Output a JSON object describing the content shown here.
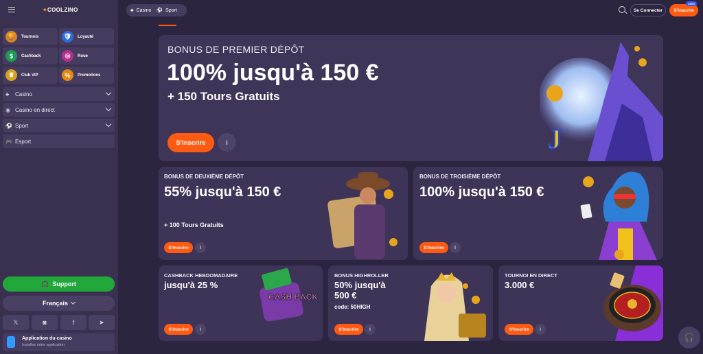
{
  "brand": {
    "name_prefix": "",
    "name": "COOLZINO"
  },
  "sidebar": {
    "tiles": [
      {
        "label": "Tournois",
        "icon": "trophy-icon",
        "color": "#d7832a"
      },
      {
        "label": "Loyauté",
        "icon": "shield-icon",
        "color": "#2e6bd6"
      },
      {
        "label": "Cashback",
        "icon": "cashback-icon",
        "color": "#1c9a55"
      },
      {
        "label": "Roue",
        "icon": "wheel-icon",
        "color": "#b6318f"
      },
      {
        "label": "Club VIP",
        "icon": "crown-icon",
        "color": "#d9a21f"
      },
      {
        "label": "Promotions",
        "icon": "percent-icon",
        "color": "#e48a12"
      }
    ],
    "nav": [
      {
        "label": "Casino",
        "icon": "cards-icon"
      },
      {
        "label": "Casino en direct",
        "icon": "live-icon"
      },
      {
        "label": "Sport",
        "icon": "ball-icon"
      },
      {
        "label": "Esport",
        "icon": "gamepad-icon"
      }
    ],
    "support_label": "Support",
    "language_label": "Français",
    "socials": [
      "x-icon",
      "instagram-icon",
      "facebook-icon",
      "telegram-icon"
    ],
    "app": {
      "title": "Application du casino",
      "subtitle": "Installez notre application"
    }
  },
  "topbar": {
    "casino_label": "Casino",
    "sport_label": "Sport",
    "connect_label": "Se Connecter",
    "signup_label": "S'inscrire",
    "signup_badge": "150%"
  },
  "hero": {
    "kicker": "BONUS DE PREMIER DÉPÔT",
    "headline": "100% jusqu'à 150 €",
    "subline": "+ 150 Tours Gratuits",
    "button": "S'inscrire"
  },
  "promos": [
    {
      "kicker": "BONUS DE DEUXIÈME DÉPÔT",
      "headline": "55% jusqu'à 150 €",
      "subline": "+ 100 Tours Gratuits",
      "button": "S'inscrire"
    },
    {
      "kicker": "BONUS DE TROISIÈME DÉPÔT",
      "headline": "100% jusqu'à 150 €",
      "subline": "",
      "button": "S'inscrire"
    },
    {
      "kicker": "CASHBACK HEBDOMADAIRE",
      "headline": "jusqu'à 25 %",
      "subline": "",
      "button": "S'inscrire",
      "art_text": "CASH BACK"
    },
    {
      "kicker": "BONUS HIGHROLLER",
      "headline": "50% jusqu'à 500 €",
      "subline": "code: 50HIGH",
      "button": "S'inscrire"
    },
    {
      "kicker": "TOURNOI EN DIRECT",
      "headline": "3.000 €",
      "subline": "",
      "button": "S'inscrire"
    }
  ],
  "colors": {
    "accent": "#ff5a12",
    "support": "#22a83a",
    "bg": "#2c2540",
    "card": "#3e3458"
  }
}
